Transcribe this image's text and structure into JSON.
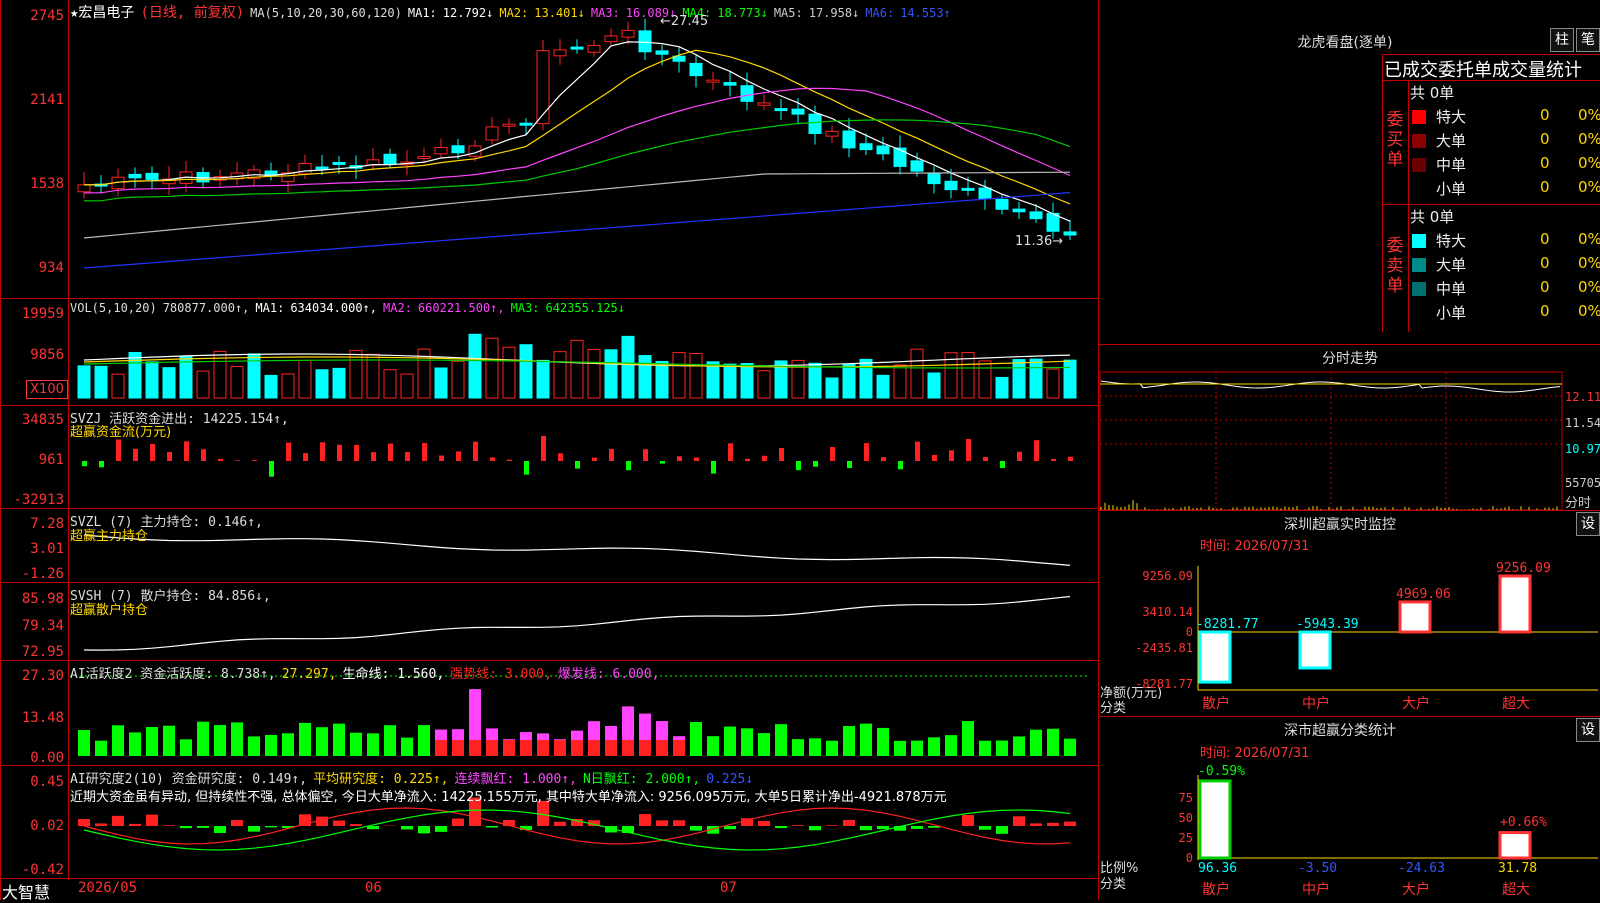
{
  "stock": {
    "name": "★宏昌电子",
    "mode": "(日线, 前复权)",
    "ma_label": "MA(5,10,20,30,60,120)",
    "ma": [
      {
        "label": "MA1:",
        "value": "12.792↓",
        "color": "#ffffff"
      },
      {
        "label": "MA2:",
        "value": "13.401↓",
        "color": "#ffd700"
      },
      {
        "label": "MA3:",
        "value": "16.089↓",
        "color": "#ff44ff"
      },
      {
        "label": "MA4:",
        "value": "18.773↓",
        "color": "#00ff00"
      },
      {
        "label": "MA5:",
        "value": "17.958↓",
        "color": "#cccccc"
      },
      {
        "label": "MA6:",
        "value": "14.553↑",
        "color": "#3355ff"
      }
    ],
    "high_mark": "27.45",
    "low_mark": "11.36",
    "y_ticks": [
      "2745",
      "2141",
      "1538",
      "934"
    ]
  },
  "volume": {
    "label": "VOL(5,10,20)",
    "value": "780877.000↑,",
    "ma": [
      {
        "label": "MA1:",
        "value": "634034.000↑,",
        "color": "#ffffff"
      },
      {
        "label": "MA2:",
        "value": "660221.500↑,",
        "color": "#ff44ff"
      },
      {
        "label": "MA3:",
        "value": "642355.125↓",
        "color": "#00ff00"
      }
    ],
    "y_ticks": [
      "19959",
      "9856"
    ],
    "unit": "X100"
  },
  "svzj": {
    "label": "SVZJ  活跃资金进出: 14225.154↑,",
    "sub": "超赢资金流(万元)",
    "y_ticks": [
      "34835",
      "961",
      "-32913"
    ]
  },
  "svzl": {
    "label": "SVZL (7) 主力持仓: 0.146↑,",
    "sub": "超赢主力持仓",
    "y_ticks": [
      "7.28",
      "3.01",
      "-1.26"
    ]
  },
  "svsh": {
    "label": "SVSH (7) 散户持仓: 84.856↓,",
    "sub": "超赢散户持仓",
    "y_ticks": [
      "85.98",
      "79.34",
      "72.95"
    ]
  },
  "ai_active": {
    "label": "AI活跃度2 资金活跃度: 8.738↑,",
    "v2": "27.297,",
    "v3": "生命线: 1.560,",
    "v4": "强势线: 3.000,",
    "v5": "爆发线: 6.000,",
    "y_ticks": [
      "27.30",
      "13.48",
      "0.00"
    ]
  },
  "ai_research": {
    "label": "AI研究度2(10) 资金研究度: 0.149↑,",
    "avg": "平均研究度: 0.225↑,",
    "red": "连续飘红: 1.000↑,",
    "nday": "N日飘红: 2.000↑,",
    "last": "0.225↓",
    "summary": "近期大资金虽有异动, 但持续性不强, 总体偏空, 今日大单净流入: 14225.155万元, 其中特大单净流入: 9256.095万元, 大单5日累计净出-4921.878万元",
    "y_ticks": [
      "0.45",
      "0.02",
      "-0.42"
    ]
  },
  "x_axis": {
    "brand": "大智慧",
    "labels": [
      "2026/05",
      "06",
      "07"
    ]
  },
  "right": {
    "dragon_title": "龙虎看盘(逐单)",
    "btn1": "柱",
    "btn2": "笔",
    "section_title": "已成交委托单成交量统计",
    "buy": {
      "side": "委买单",
      "total": "共 0单",
      "rows": [
        {
          "name": "特大",
          "count": "0",
          "pct": "0%",
          "color": "#ff0000"
        },
        {
          "name": "大单",
          "count": "0",
          "pct": "0%",
          "color": "#8b0000"
        },
        {
          "name": "中单",
          "count": "0",
          "pct": "0%",
          "color": "#6a0000"
        },
        {
          "name": "小单",
          "count": "0",
          "pct": "0%",
          "color": ""
        }
      ]
    },
    "sell": {
      "side": "委卖单",
      "total": "共 0单",
      "rows": [
        {
          "name": "特大",
          "count": "0",
          "pct": "0%",
          "color": "#00ffff"
        },
        {
          "name": "大单",
          "count": "0",
          "pct": "0%",
          "color": "#008b8b"
        },
        {
          "name": "中单",
          "count": "0",
          "pct": "0%",
          "color": "#007070"
        },
        {
          "name": "小单",
          "count": "0",
          "pct": "0%",
          "color": ""
        }
      ]
    },
    "intraday": {
      "title": "分时走势",
      "prices": [
        "12.11",
        "11.54",
        "10.97"
      ],
      "vol": "55705",
      "vol_label": "分时"
    },
    "sz_monitor": {
      "title": "深圳超赢实时监控",
      "btn": "设",
      "time": "时间: 2026/07/31",
      "y_ticks": [
        "9256.09",
        "3410.14",
        "0",
        "-2435.81",
        "-8281.77"
      ],
      "unit": "净额(万元)",
      "xcap": "分类",
      "categories": [
        "散户",
        "中户",
        "大户",
        "超大"
      ],
      "values": [
        "-8281.77",
        "-5943.39",
        "4969.06",
        "9256.09"
      ]
    },
    "sz_class": {
      "title": "深市超赢分类统计",
      "btn": "设",
      "time": "时间: 2026/07/31",
      "y_ticks": [
        "75",
        "50",
        "25",
        "0"
      ],
      "unit": "比例%",
      "xcap": "分类",
      "top_labels": [
        "-0.59%",
        "+0.66%"
      ],
      "categories": [
        "散户",
        "中户",
        "大户",
        "超大"
      ],
      "values": [
        "96.36",
        "-3.50",
        "-24.63",
        "31.78"
      ]
    }
  }
}
